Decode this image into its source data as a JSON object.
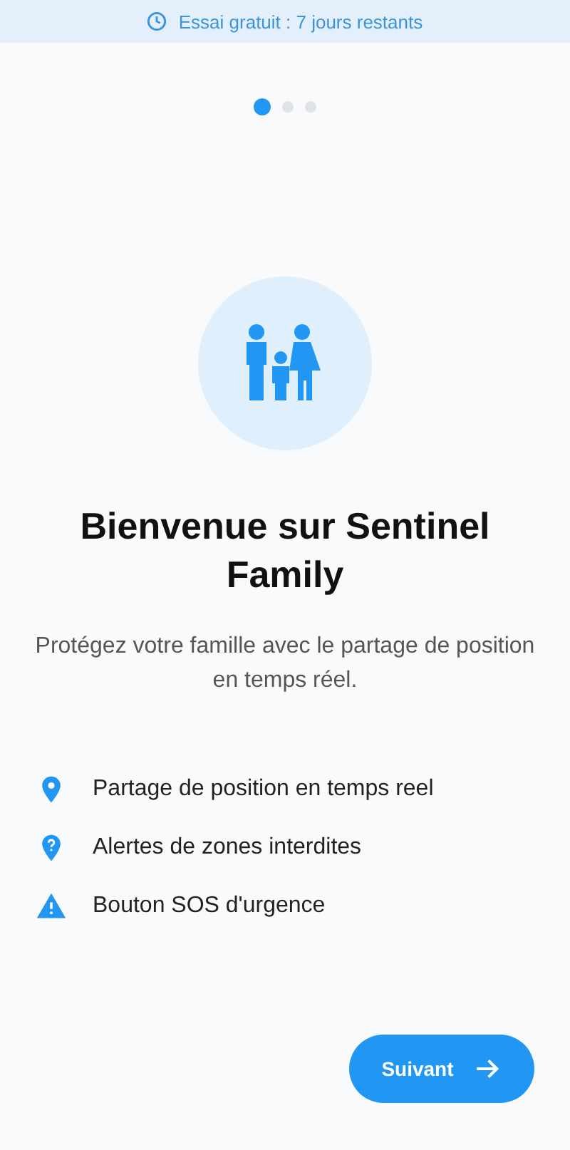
{
  "banner": {
    "text": "Essai gratuit : 7 jours restants"
  },
  "pager": [
    {
      "selected": true
    },
    {
      "selected": false
    },
    {
      "selected": false
    }
  ],
  "title": "Bienvenue sur Sentinel Family",
  "subtitle": "Protégez votre famille avec le partage de position en temps réel.",
  "features": [
    {
      "kind": "pin",
      "label": "Partage de position en temps reel"
    },
    {
      "kind": "pin-question",
      "label": "Alertes de zones interdites"
    },
    {
      "kind": "warning",
      "label": "Bouton SOS d'urgence"
    }
  ],
  "next_button": {
    "label": "Suivant"
  }
}
